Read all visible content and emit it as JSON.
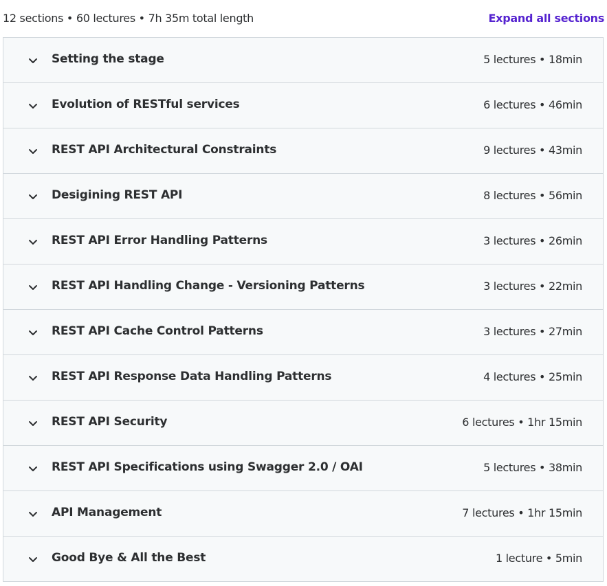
{
  "summary": {
    "text": "12 sections • 60 lectures • 7h 35m total length",
    "expand_label": "Expand all sections"
  },
  "colors": {
    "accent": "#5624d0",
    "row_background": "#f7f9fa",
    "border": "#d1d7dc",
    "text": "#2d2f31"
  },
  "sections": [
    {
      "title": "Setting the stage",
      "meta": "5 lectures • 18min",
      "icon": "chevron-down-icon"
    },
    {
      "title": "Evolution of RESTful services",
      "meta": "6 lectures • 46min",
      "icon": "chevron-down-icon"
    },
    {
      "title": "REST API Architectural Constraints",
      "meta": "9 lectures • 43min",
      "icon": "chevron-down-icon"
    },
    {
      "title": "Desigining REST API",
      "meta": "8 lectures • 56min",
      "icon": "chevron-down-icon"
    },
    {
      "title": "REST API Error Handling Patterns",
      "meta": "3 lectures • 26min",
      "icon": "chevron-down-icon"
    },
    {
      "title": "REST API Handling Change - Versioning Patterns",
      "meta": "3 lectures • 22min",
      "icon": "chevron-down-icon"
    },
    {
      "title": "REST API Cache Control Patterns",
      "meta": "3 lectures • 27min",
      "icon": "chevron-down-icon"
    },
    {
      "title": "REST API Response Data Handling Patterns",
      "meta": "4 lectures • 25min",
      "icon": "chevron-down-icon"
    },
    {
      "title": "REST API Security",
      "meta": "6 lectures • 1hr 15min",
      "icon": "chevron-down-icon"
    },
    {
      "title": "REST API Specifications using Swagger 2.0 / OAI",
      "meta": "5 lectures • 38min",
      "icon": "chevron-down-icon"
    },
    {
      "title": "API Management",
      "meta": "7 lectures • 1hr 15min",
      "icon": "chevron-down-icon"
    },
    {
      "title": "Good Bye & All the Best",
      "meta": "1 lecture • 5min",
      "icon": "chevron-down-icon"
    }
  ]
}
